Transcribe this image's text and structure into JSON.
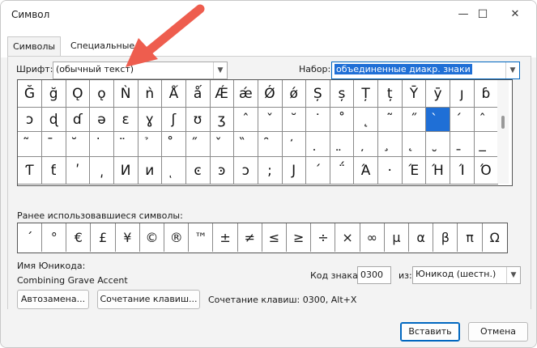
{
  "window": {
    "title": "Символ",
    "minimize": "—",
    "maximize": "☐",
    "close": "✕"
  },
  "tabs": [
    {
      "label": "Символы"
    },
    {
      "label": "Специальные з"
    }
  ],
  "font": {
    "label": "Шрифт:",
    "value": "(обычный текст)"
  },
  "subset": {
    "label": "Набор:",
    "value": "объединенные диакр. знаки"
  },
  "grid": {
    "rows": [
      [
        "Ğ",
        "ğ",
        "Ǫ",
        "ǫ",
        "Ǹ",
        "ǹ",
        "Ǻ",
        "ǻ",
        "Ǽ",
        "ǽ",
        "Ǿ",
        "ǿ",
        "Ș",
        "ș",
        "Ț",
        "ț",
        "Ȳ",
        "ȳ",
        "ȷ",
        "ɓ"
      ],
      [
        "ɔ",
        "ɖ",
        "ɗ",
        "ə",
        "ɛ",
        "ɣ",
        "ʃ",
        "ʊ",
        "ʒ",
        "ˆ",
        "ˇ",
        "˘",
        "˙",
        "˚",
        "˛",
        "˜",
        "˝",
        "̀",
        "́",
        "̂"
      ],
      [
        "̃",
        "̄",
        "̆",
        "̇",
        "̈",
        "̉",
        "̊",
        "̋",
        "̌",
        "̏",
        "̑",
        "̒",
        "̣",
        "̤",
        "̦",
        "̧",
        "̨",
        "̮",
        "̱",
        "̲"
      ],
      [
        "Ƭ",
        "ƭ",
        "ʹ",
        "͵",
        "И",
        "и",
        "ͅ",
        "ͼ",
        "ͽ",
        "ͻ",
        ";",
        "Ϳ",
        "΄",
        "΅",
        "Ά",
        "·",
        "Έ",
        "Ή",
        "Ί",
        "Ό"
      ]
    ],
    "selected": {
      "row": 1,
      "col": 17
    }
  },
  "recent": {
    "label": "Ранее использовавшиеся символы:",
    "symbols": [
      "ˊ",
      "°",
      "€",
      "£",
      "¥",
      "©",
      "®",
      "™",
      "±",
      "≠",
      "≤",
      "≥",
      "÷",
      "×",
      "∞",
      "µ",
      "α",
      "β",
      "π",
      "Ω"
    ]
  },
  "unicode_name": {
    "label": "Имя Юникода:",
    "value": "Combining Grave Accent"
  },
  "code": {
    "label": "Код знака:",
    "value": "0300",
    "from_label": "из:",
    "from_value": "Юникод (шестн.)"
  },
  "buttons": {
    "autocorrect": "Автозамена...",
    "shortcut": "Сочетание клавиш...",
    "insert": "Вставить",
    "cancel": "Отмена"
  },
  "shortcut_text": "Сочетание клавиш: 0300, Alt+X",
  "colors": {
    "selection": "#1f6fd6",
    "annotation_arrow": "#ee5d4e",
    "accent_border": "#0067c0"
  }
}
